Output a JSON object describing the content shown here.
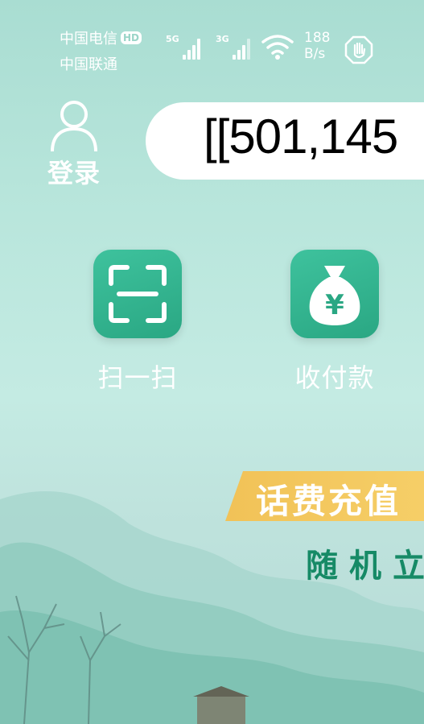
{
  "status_bar": {
    "carrier_primary": "中国电信",
    "hd_badge": "HD",
    "carrier_secondary": "中国联通",
    "signal_1_tag": "5G",
    "signal_2_tag": "3G",
    "speed_value": "188",
    "speed_unit": "B/s",
    "icons": [
      "signal-icon",
      "wifi-icon",
      "hand-icon"
    ]
  },
  "header": {
    "login_label": "登录",
    "search_text": "[[501,145"
  },
  "actions": [
    {
      "label": "扫一扫",
      "icon": "scan-icon"
    },
    {
      "label": "收付款",
      "icon": "money-bag-icon"
    }
  ],
  "promo": {
    "banner_title": "话费充值",
    "subtitle": "随机立"
  },
  "colors": {
    "accent": "#2fb38c",
    "banner": "#f3c65e",
    "calligraphy": "#168a66",
    "background": "#b9e6dc"
  }
}
